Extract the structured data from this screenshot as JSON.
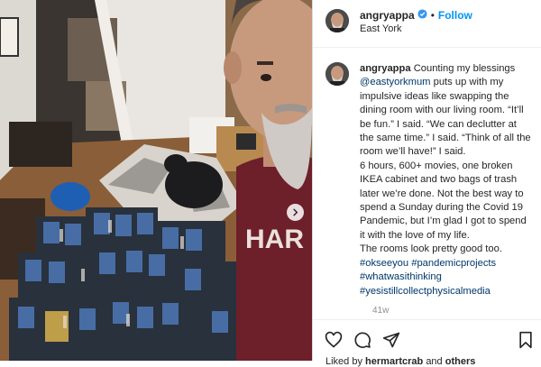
{
  "post": {
    "username": "angryappa",
    "follow_label": "Follow",
    "separator": "•",
    "location": "East York",
    "caption_lines": [
      "Counting my blessings",
      "@eastyorkmum puts up with my",
      "impulsive ideas like swapping the",
      "dining room with our living room. “It’ll",
      "be fun.” I said. “We can declutter at",
      "the same time.” I said. “Think of all the",
      "room we’ll have!” I said.",
      "6 hours, 600+ movies, one broken",
      "IKEA cabinet and two bags of trash",
      "later we’re done. Not the best way to",
      "spend a Sunday during the Covid 19",
      "Pandemic, but I’m glad I got to spend",
      "it with the love of my life.",
      "The rooms look pretty good too.",
      "#okseeyou #pandemicprojects",
      "#whatwasithinking",
      "#yesistillcollectphysicalmedia"
    ],
    "time_ago": "41w",
    "liked_prefix": "Liked by",
    "liked_user": "hermartcrab",
    "liked_suffix": "and",
    "liked_others": "others"
  },
  "icons": {
    "verified": "verified-badge-icon",
    "carousel_next": "chevron-right-icon",
    "like": "heart-icon",
    "comment": "comment-icon",
    "share": "paper-plane-icon",
    "save": "bookmark-icon"
  },
  "colors": {
    "link_blue": "#0095f6",
    "hashtag": "#00376b",
    "muted": "#8e8e8e",
    "text": "#262626"
  }
}
